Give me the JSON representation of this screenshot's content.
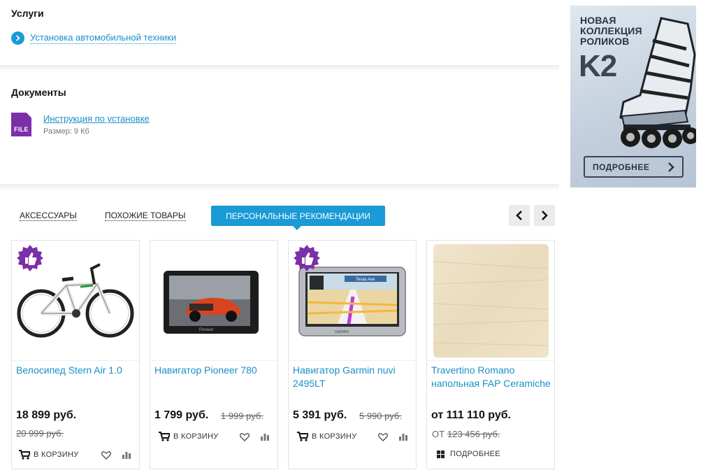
{
  "services": {
    "title": "Услуги",
    "link": "Установка автомобильной техники"
  },
  "documents": {
    "title": "Документы",
    "file_label": "FILE",
    "link": "Инструкция по установке",
    "size": "Размер: 9 Кб"
  },
  "banner": {
    "line1": "НОВАЯ",
    "line2": "КОЛЛЕКЦИЯ",
    "line3": "РОЛИКОВ",
    "brand": "K2",
    "button": "ПОДРОБНЕЕ"
  },
  "tabs": [
    {
      "label": "АКСЕССУАРЫ",
      "active": false
    },
    {
      "label": "ПОХОЖИЕ ТОВАРЫ",
      "active": false
    },
    {
      "label": "ПЕРСОНАЛЬНЫЕ РЕКОМЕНДАЦИИ",
      "active": true
    }
  ],
  "products": [
    {
      "name": "Велосипед Stern Air 1.0",
      "price": "18 899 руб.",
      "old_price": "20 999 руб.",
      "action": "В КОРЗИНУ",
      "badge": "thumbs-up"
    },
    {
      "name": "Навигатор Pioneer 780",
      "price": "1 799 руб.",
      "old_price": "1 999 руб.",
      "action": "В КОРЗИНУ",
      "screen_brand": "Pioneer"
    },
    {
      "name": "Навигатор Garmin nuvi 2495LT",
      "price": "5 391 руб.",
      "old_price": "5 990 руб.",
      "action": "В КОРЗИНУ",
      "badge": "thumbs-up",
      "map_street": "Texas Ave",
      "brand": "GARMIN"
    },
    {
      "name": "Travertino Romano напольная FAP Ceramiche",
      "price": "от 111 110 руб.",
      "from_label": "ОТ",
      "old_price": "123 456 руб.",
      "action": "ПОДРОБНЕЕ"
    }
  ],
  "colors": {
    "accent": "#1a9ad6",
    "link": "#1a8fc7",
    "badge": "#7b2fa8"
  }
}
